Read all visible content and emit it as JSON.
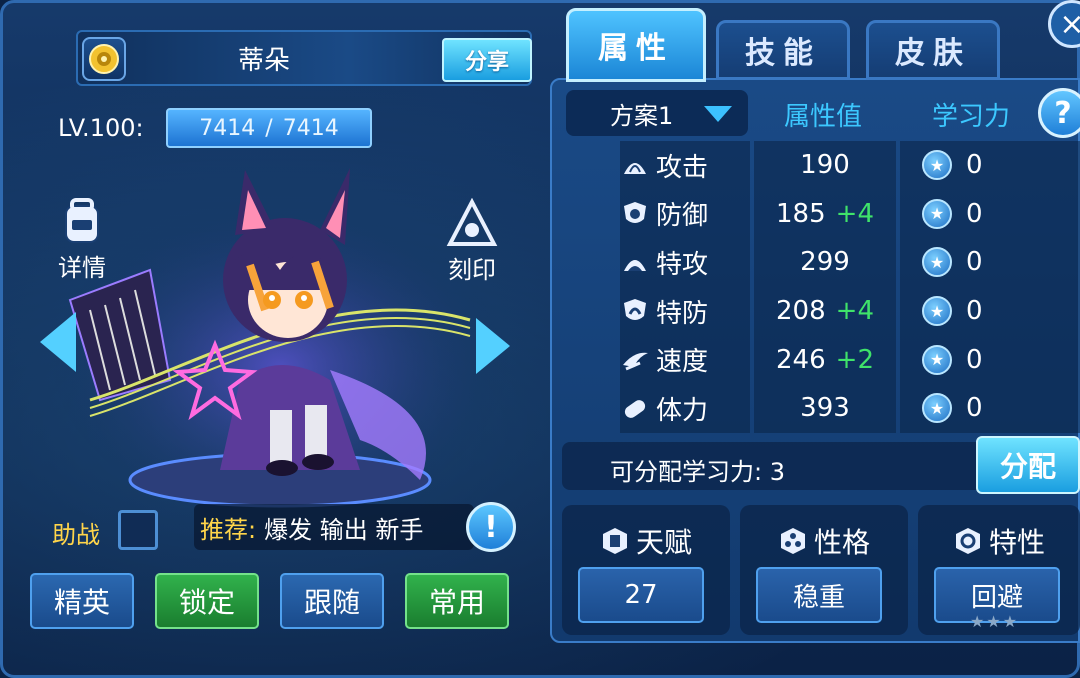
{
  "character": {
    "name": "蒂朵",
    "share_label": "分享",
    "level_label": "LV.100:",
    "hp_current": "7414",
    "hp_separator": "/",
    "hp_max": "7414"
  },
  "side_icons": {
    "details_label": "详情",
    "imprint_label": "刻印"
  },
  "assist": {
    "label": "助战"
  },
  "recommend": {
    "prefix": "推荐:",
    "tags": "爆发 输出 新手",
    "info_symbol": "!"
  },
  "bottom_buttons": [
    {
      "label": "精英",
      "style": "blue"
    },
    {
      "label": "锁定",
      "style": "green"
    },
    {
      "label": "跟随",
      "style": "blue"
    },
    {
      "label": "常用",
      "style": "green"
    }
  ],
  "tabs": [
    {
      "label": "属性",
      "active": true
    },
    {
      "label": "技能",
      "active": false
    },
    {
      "label": "皮肤",
      "active": false
    }
  ],
  "close_symbol": "×",
  "stats_panel": {
    "plan_label": "方案1",
    "col_value": "属性值",
    "col_learning": "学习力",
    "help_symbol": "?",
    "rows": [
      {
        "icon": "attack-icon",
        "name": "攻击",
        "value": "190",
        "bonus": "",
        "learning": "0"
      },
      {
        "icon": "defense-icon",
        "name": "防御",
        "value": "185",
        "bonus": "+4",
        "learning": "0"
      },
      {
        "icon": "special-attack-icon",
        "name": "特攻",
        "value": "299",
        "bonus": "",
        "learning": "0"
      },
      {
        "icon": "special-defense-icon",
        "name": "特防",
        "value": "208",
        "bonus": "+4",
        "learning": "0"
      },
      {
        "icon": "speed-icon",
        "name": "速度",
        "value": "246",
        "bonus": "+2",
        "learning": "0"
      },
      {
        "icon": "stamina-icon",
        "name": "体力",
        "value": "393",
        "bonus": "",
        "learning": "0"
      }
    ],
    "allocatable_label": "可分配学习力:",
    "allocatable_value": "3",
    "allocate_button": "分配"
  },
  "cards": [
    {
      "title": "天赋",
      "value": "27",
      "icon": "talent-icon"
    },
    {
      "title": "性格",
      "value": "稳重",
      "icon": "nature-icon"
    },
    {
      "title": "特性",
      "value": "回避",
      "icon": "trait-icon"
    }
  ],
  "colors": {
    "accent": "#3cc8ff",
    "bonus_green": "#3fe36a",
    "recommend_gold": "#ffd54a",
    "green_button": "#31b24c"
  }
}
